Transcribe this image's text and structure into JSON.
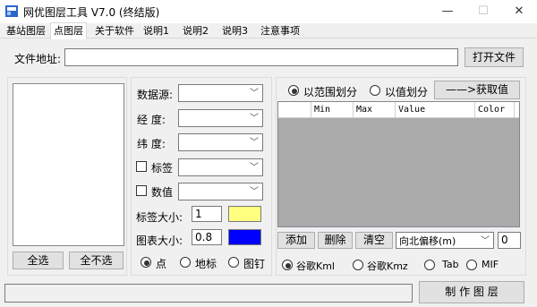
{
  "window": {
    "title": "网优图层工具 V7.0 (终结版)",
    "minimize": "—",
    "maximize": "☐",
    "close": "✕"
  },
  "tabs": [
    "基站图层",
    "点图层",
    "关于软件",
    "说明1",
    "说明2",
    "说明3",
    "注意事项"
  ],
  "active_tab": 1,
  "file": {
    "label": "文件地址:",
    "value": "",
    "open_button": "打开文件"
  },
  "left_panel": {
    "select_all": "全选",
    "select_none": "全不选"
  },
  "fields": {
    "datasource_label": "数据源:",
    "longitude_label": "经 度:",
    "latitude_label": "纬 度:",
    "label_check": "标签",
    "value_check": "数值",
    "label_size_label": "标签大小:",
    "label_size_value": "1",
    "chart_size_label": "图表大小:",
    "chart_size_value": "0.8",
    "label_color": "#ffff80",
    "chart_color": "#0000ff",
    "combo_arrow": "﹀"
  },
  "point_type": {
    "options": [
      "点",
      "地标",
      "图钉"
    ],
    "selected": 0
  },
  "range": {
    "by_range": "以范围划分",
    "by_value": "以值划分",
    "get_value_button": "——>获取值",
    "columns": [
      "",
      "Min",
      "Max",
      "Value",
      "Color"
    ]
  },
  "grid_actions": {
    "add": "添加",
    "delete": "删除",
    "clear": "清空",
    "offset_option": "向北偏移(m)",
    "offset_value": "0"
  },
  "export_format": {
    "options": [
      "谷歌Kml",
      "谷歌Kmz",
      "Tab",
      "MIF"
    ],
    "selected": 0
  },
  "footer": {
    "status": "",
    "make_button": "制 作 图 层"
  }
}
